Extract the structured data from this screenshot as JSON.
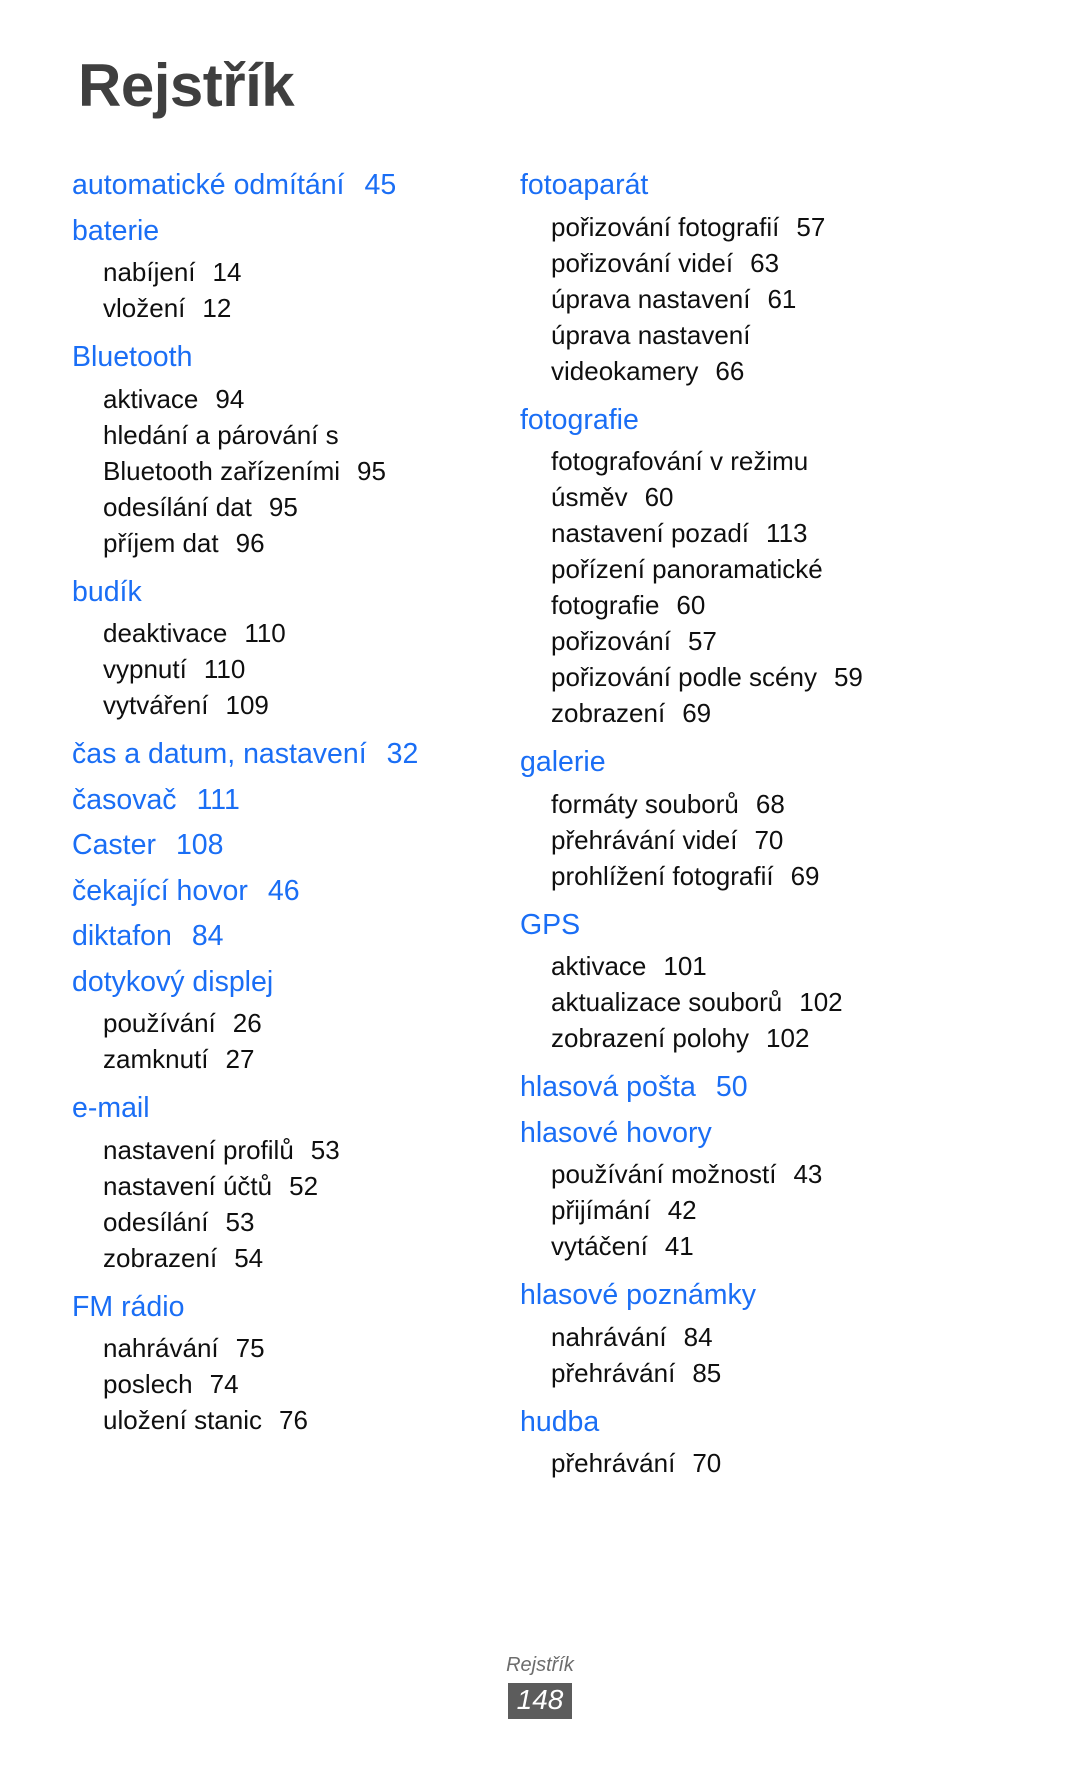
{
  "page": {
    "title": "Rejstřík",
    "footer_label": "Rejstřík",
    "page_number": "148",
    "heading_color": "#1a6ef5",
    "title_color": "#3f3f3f",
    "subentry_color": "#0f0f0f",
    "footer_box_color": "#5c5c5c"
  },
  "columns": [
    {
      "id": "left",
      "groups": [
        {
          "heading": "automatické odmítání",
          "heading_page": "45",
          "subentries": []
        },
        {
          "heading": "baterie",
          "heading_page": "",
          "subentries": [
            {
              "label": "nabíjení",
              "page": "14"
            },
            {
              "label": "vložení",
              "page": "12"
            }
          ]
        },
        {
          "heading": "Bluetooth",
          "heading_page": "",
          "subentries": [
            {
              "label": "aktivace",
              "page": "94"
            },
            {
              "label": "hledání a párování s",
              "page": ""
            },
            {
              "label": "Bluetooth zařízeními",
              "page": "95"
            },
            {
              "label": "odesílání dat",
              "page": "95"
            },
            {
              "label": "příjem dat",
              "page": "96"
            }
          ]
        },
        {
          "heading": "budík",
          "heading_page": "",
          "subentries": [
            {
              "label": "deaktivace",
              "page": "110"
            },
            {
              "label": "vypnutí",
              "page": "110"
            },
            {
              "label": "vytváření",
              "page": "109"
            }
          ]
        },
        {
          "heading": "čas a datum, nastavení",
          "heading_page": "32",
          "subentries": []
        },
        {
          "heading": "časovač",
          "heading_page": "111",
          "subentries": []
        },
        {
          "heading": "Caster",
          "heading_page": "108",
          "subentries": []
        },
        {
          "heading": "čekající hovor",
          "heading_page": "46",
          "subentries": []
        },
        {
          "heading": "diktafon",
          "heading_page": "84",
          "subentries": []
        },
        {
          "heading": "dotykový displej",
          "heading_page": "",
          "subentries": [
            {
              "label": "používání",
              "page": "26"
            },
            {
              "label": "zamknutí",
              "page": "27"
            }
          ]
        },
        {
          "heading": "e-mail",
          "heading_page": "",
          "subentries": [
            {
              "label": "nastavení profilů",
              "page": "53"
            },
            {
              "label": "nastavení účtů",
              "page": "52"
            },
            {
              "label": "odesílání",
              "page": "53"
            },
            {
              "label": "zobrazení",
              "page": "54"
            }
          ]
        },
        {
          "heading": "FM rádio",
          "heading_page": "",
          "subentries": [
            {
              "label": "nahrávání",
              "page": "75"
            },
            {
              "label": "poslech",
              "page": "74"
            },
            {
              "label": "uložení stanic",
              "page": "76"
            }
          ]
        }
      ]
    },
    {
      "id": "right",
      "groups": [
        {
          "heading": "fotoaparát",
          "heading_page": "",
          "subentries": [
            {
              "label": "pořizování fotografií",
              "page": "57"
            },
            {
              "label": "pořizování videí",
              "page": "63"
            },
            {
              "label": "úprava nastavení",
              "page": "61"
            },
            {
              "label": "úprava nastavení",
              "page": ""
            },
            {
              "label": "videokamery",
              "page": "66"
            }
          ]
        },
        {
          "heading": "fotografie",
          "heading_page": "",
          "subentries": [
            {
              "label": "fotografování v režimu",
              "page": ""
            },
            {
              "label": "úsměv",
              "page": "60"
            },
            {
              "label": "nastavení pozadí",
              "page": "113"
            },
            {
              "label": "pořízení panoramatické",
              "page": ""
            },
            {
              "label": "fotografie",
              "page": "60"
            },
            {
              "label": "pořizování",
              "page": "57"
            },
            {
              "label": "pořizování podle scény",
              "page": "59"
            },
            {
              "label": "zobrazení",
              "page": "69"
            }
          ]
        },
        {
          "heading": "galerie",
          "heading_page": "",
          "subentries": [
            {
              "label": "formáty souborů",
              "page": "68"
            },
            {
              "label": "přehrávání videí",
              "page": "70"
            },
            {
              "label": "prohlížení fotografií",
              "page": "69"
            }
          ]
        },
        {
          "heading": "GPS",
          "heading_page": "",
          "subentries": [
            {
              "label": "aktivace",
              "page": "101"
            },
            {
              "label": "aktualizace souborů",
              "page": "102"
            },
            {
              "label": "zobrazení polohy",
              "page": "102"
            }
          ]
        },
        {
          "heading": "hlasová pošta",
          "heading_page": "50",
          "subentries": []
        },
        {
          "heading": "hlasové hovory",
          "heading_page": "",
          "subentries": [
            {
              "label": "používání možností",
              "page": "43"
            },
            {
              "label": "přijímání",
              "page": "42"
            },
            {
              "label": "vytáčení",
              "page": "41"
            }
          ]
        },
        {
          "heading": "hlasové poznámky",
          "heading_page": "",
          "subentries": [
            {
              "label": "nahrávání",
              "page": "84"
            },
            {
              "label": "přehrávání",
              "page": "85"
            }
          ]
        },
        {
          "heading": "hudba",
          "heading_page": "",
          "subentries": [
            {
              "label": "přehrávání",
              "page": "70"
            }
          ]
        }
      ]
    }
  ]
}
